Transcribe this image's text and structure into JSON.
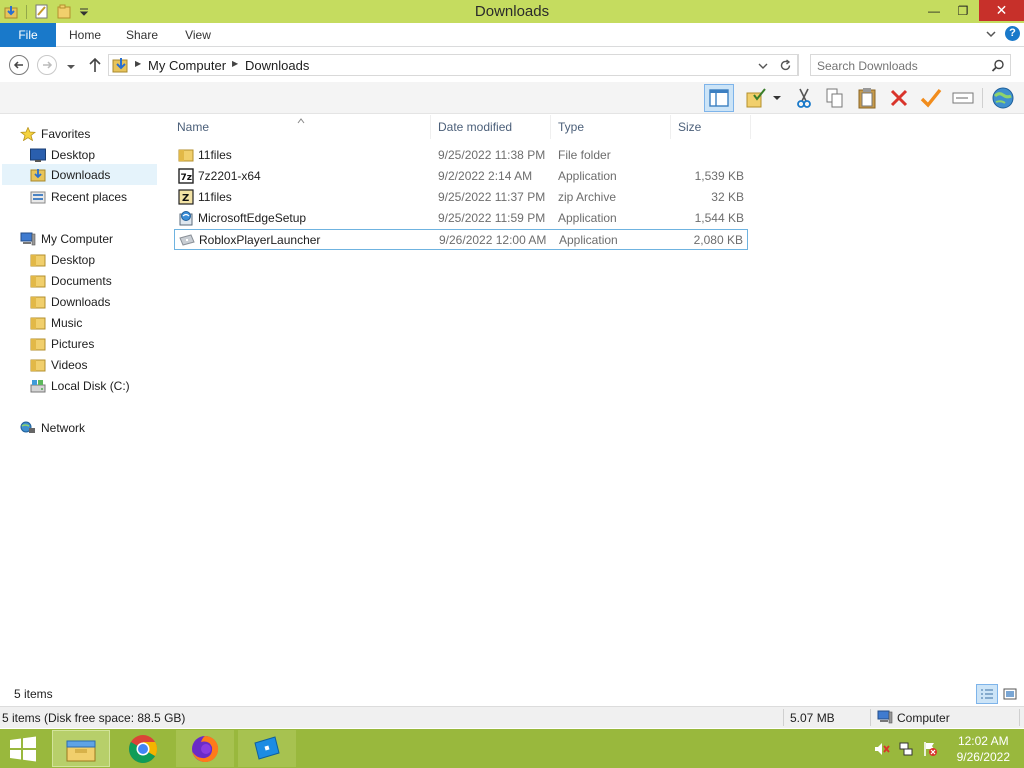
{
  "window": {
    "title": "Downloads",
    "controls": {
      "minimize": "—",
      "maximize": "❐",
      "close": "✕"
    }
  },
  "ribbon": {
    "tabs": [
      {
        "label": "File"
      },
      {
        "label": "Home"
      },
      {
        "label": "Share"
      },
      {
        "label": "View"
      }
    ],
    "expand_icon": "chevron-down-icon",
    "help_icon": "help-icon",
    "help_glyph": "?"
  },
  "address": {
    "crumbs": [
      "My Computer",
      "Downloads"
    ],
    "search_placeholder": "Search Downloads"
  },
  "nav_pane": {
    "favorites": {
      "label": "Favorites",
      "items": [
        {
          "label": "Desktop",
          "icon": "desktop-icon"
        },
        {
          "label": "Downloads",
          "icon": "downloads-folder-icon",
          "selected": true
        },
        {
          "label": "Recent places",
          "icon": "recent-places-icon"
        }
      ]
    },
    "computer": {
      "label": "My Computer",
      "items": [
        {
          "label": "Desktop",
          "icon": "folder-icon"
        },
        {
          "label": "Documents",
          "icon": "folder-icon"
        },
        {
          "label": "Downloads",
          "icon": "folder-icon"
        },
        {
          "label": "Music",
          "icon": "folder-icon"
        },
        {
          "label": "Pictures",
          "icon": "folder-icon"
        },
        {
          "label": "Videos",
          "icon": "folder-icon"
        },
        {
          "label": "Local Disk (C:)",
          "icon": "drive-icon"
        }
      ]
    },
    "network": {
      "label": "Network"
    }
  },
  "file_list": {
    "columns": [
      "Name",
      "Date modified",
      "Type",
      "Size"
    ],
    "rows": [
      {
        "name": "11files",
        "date": "9/25/2022 11:38 PM",
        "type": "File folder",
        "size": "",
        "icon": "folder-icon"
      },
      {
        "name": "7z2201-x64",
        "date": "9/2/2022 2:14 AM",
        "type": "Application",
        "size": "1,539 KB",
        "icon": "7zip-icon"
      },
      {
        "name": "11files",
        "date": "9/25/2022 11:37 PM",
        "type": "zip Archive",
        "size": "32 KB",
        "icon": "zip-archive-icon"
      },
      {
        "name": "MicrosoftEdgeSetup",
        "date": "9/25/2022 11:59 PM",
        "type": "Application",
        "size": "1,544 KB",
        "icon": "installer-icon"
      },
      {
        "name": "RobloxPlayerLauncher",
        "date": "9/26/2022 12:00 AM",
        "type": "Application",
        "size": "2,080 KB",
        "icon": "roblox-icon"
      }
    ]
  },
  "status": {
    "item_count": "5 items",
    "details_left": "5 items (Disk free space: 88.5 GB)",
    "details_size": "5.07 MB",
    "details_location": "Computer"
  },
  "taskbar": {
    "apps": [
      "file-explorer-icon",
      "chrome-icon",
      "firefox-icon",
      "roblox-studio-icon"
    ],
    "clock_time": "12:02 AM",
    "clock_date": "9/26/2022"
  },
  "colors": {
    "titlebar": "#c5dc5f",
    "file_tab": "#1979ca",
    "taskbar": "#99b83d",
    "selection": "#e5f3fb",
    "focus_border": "#6fb3e0",
    "close_button": "#c7302a"
  }
}
